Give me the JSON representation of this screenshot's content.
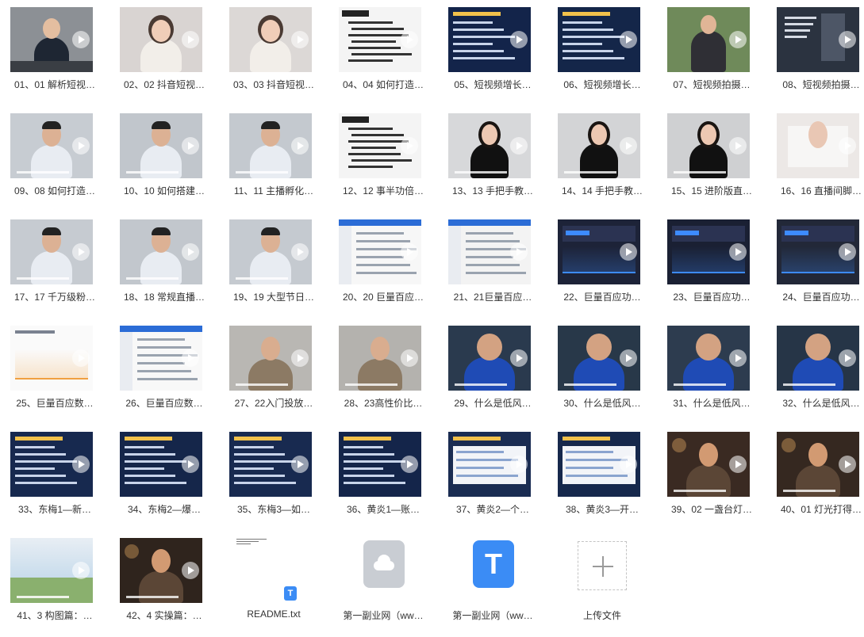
{
  "files": [
    {
      "name": "01、01 解析短视…",
      "kind": "video",
      "scene": "presenter-desk",
      "bg": "#8c9095"
    },
    {
      "name": "02、02 抖音短视…",
      "kind": "video",
      "scene": "woman-light",
      "bg": "#d9d4d2"
    },
    {
      "name": "03、03 抖音短视…",
      "kind": "video",
      "scene": "woman-light",
      "bg": "#dcd8d6"
    },
    {
      "name": "04、04 如何打造…",
      "kind": "video",
      "scene": "slide-white",
      "bg": "#f4f4f4"
    },
    {
      "name": "05、短视频增长…",
      "kind": "video",
      "scene": "slide-navy",
      "bg": "#13244a"
    },
    {
      "name": "06、短视频增长…",
      "kind": "video",
      "scene": "slide-navy",
      "bg": "#142649"
    },
    {
      "name": "07、短视频拍摄…",
      "kind": "video",
      "scene": "outdoor-person",
      "bg": "#6f8a5a"
    },
    {
      "name": "08、短视频拍摄…",
      "kind": "video",
      "scene": "dark-poster",
      "bg": "#2b3340"
    },
    {
      "name": "09、08 如何打造…",
      "kind": "video",
      "scene": "man-studio",
      "bg": "#c7ccd2"
    },
    {
      "name": "10、10 如何搭建…",
      "kind": "video",
      "scene": "man-studio",
      "bg": "#c1c6cc"
    },
    {
      "name": "11、11 主播孵化…",
      "kind": "video",
      "scene": "man-studio",
      "bg": "#c4c9cf"
    },
    {
      "name": "12、12 事半功倍…",
      "kind": "video",
      "scene": "slide-white",
      "bg": "#f4f4f4"
    },
    {
      "name": "13、13 手把手教…",
      "kind": "video",
      "scene": "woman-black",
      "bg": "#d7d8da"
    },
    {
      "name": "14、14 手把手教…",
      "kind": "video",
      "scene": "woman-black",
      "bg": "#d3d4d6"
    },
    {
      "name": "15、15 进阶版直…",
      "kind": "video",
      "scene": "woman-black",
      "bg": "#cfd0d2"
    },
    {
      "name": "16、16 直播间脚…",
      "kind": "video",
      "scene": "faded",
      "bg": "#ece8e6"
    },
    {
      "name": "17、17 千万级粉…",
      "kind": "video",
      "scene": "man-studio",
      "bg": "#c6cbd1"
    },
    {
      "name": "18、18 常规直播…",
      "kind": "video",
      "scene": "man-studio",
      "bg": "#c2c7cd"
    },
    {
      "name": "19、19 大型节日…",
      "kind": "video",
      "scene": "man-studio",
      "bg": "#c5cad0"
    },
    {
      "name": "20、20 巨量百应…",
      "kind": "video",
      "scene": "web-screen",
      "bg": "#f7f7f7"
    },
    {
      "name": "21、21巨量百应…",
      "kind": "video",
      "scene": "web-screen",
      "bg": "#f3f3f3"
    },
    {
      "name": "22、巨量百应功…",
      "kind": "video",
      "scene": "dashboard-dark",
      "bg": "#1d2338"
    },
    {
      "name": "23、巨量百应功…",
      "kind": "video",
      "scene": "dashboard-dark",
      "bg": "#1a2033"
    },
    {
      "name": "24、巨量百应功…",
      "kind": "video",
      "scene": "dashboard-dark",
      "bg": "#222838"
    },
    {
      "name": "25、巨量百应数…",
      "kind": "video",
      "scene": "chart-white",
      "bg": "#fafafa"
    },
    {
      "name": "26、巨量百应数…",
      "kind": "video",
      "scene": "web-screen",
      "bg": "#f8f8f8"
    },
    {
      "name": "27、22入门投放…",
      "kind": "video",
      "scene": "man-beige",
      "bg": "#b9b7b3"
    },
    {
      "name": "28、23高性价比…",
      "kind": "video",
      "scene": "man-beige",
      "bg": "#b4b2ae"
    },
    {
      "name": "29、什么是低风…",
      "kind": "video",
      "scene": "man-blue-hoodie",
      "bg": "#2a3a4e"
    },
    {
      "name": "30、什么是低风…",
      "kind": "video",
      "scene": "man-blue-hoodie",
      "bg": "#283849"
    },
    {
      "name": "31、什么是低风…",
      "kind": "video",
      "scene": "man-blue-hoodie",
      "bg": "#2d3c4f"
    },
    {
      "name": "32、什么是低风…",
      "kind": "video",
      "scene": "man-blue-hoodie",
      "bg": "#263547"
    },
    {
      "name": "33、东梅1—新…",
      "kind": "video",
      "scene": "slide-navy",
      "bg": "#17294f"
    },
    {
      "name": "34、东梅2—爆…",
      "kind": "video",
      "scene": "slide-navy",
      "bg": "#15264a"
    },
    {
      "name": "35、东梅3—如…",
      "kind": "video",
      "scene": "slide-navy",
      "bg": "#182a50"
    },
    {
      "name": "36、黄炎1—账…",
      "kind": "video",
      "scene": "slide-navy",
      "bg": "#14254a"
    },
    {
      "name": "37、黄炎2—个…",
      "kind": "video",
      "scene": "slide-mixed",
      "bg": "#1a2c52"
    },
    {
      "name": "38、黄炎3—开…",
      "kind": "video",
      "scene": "slide-mixed",
      "bg": "#16284c"
    },
    {
      "name": "39、02 一盏台灯…",
      "kind": "video",
      "scene": "man-warm",
      "bg": "#3a2a22"
    },
    {
      "name": "40、01 灯光打得…",
      "kind": "video",
      "scene": "man-warm",
      "bg": "#352820"
    },
    {
      "name": "41、3 构图篇：…",
      "kind": "video",
      "scene": "sky",
      "bg": "#cfe0ee"
    },
    {
      "name": "42、4 实操篇：…",
      "kind": "video",
      "scene": "man-warm",
      "bg": "#2f241d"
    },
    {
      "name": "README.txt",
      "kind": "txt"
    },
    {
      "name": "第一副业网（ww…",
      "kind": "cloud"
    },
    {
      "name": "第一副业网（ww…",
      "kind": "t-app"
    },
    {
      "name": "上传文件",
      "kind": "upload"
    }
  ],
  "colors": {
    "accent_blue": "#3b8cf5",
    "cloud_gray": "#c9cdd3",
    "upload_border": "#c4c4c4"
  }
}
